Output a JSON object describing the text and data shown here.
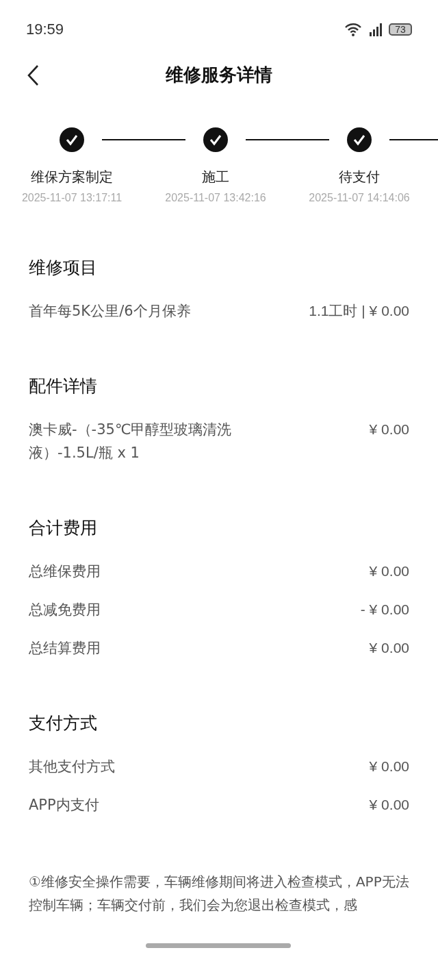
{
  "status_bar": {
    "time": "19:59",
    "battery": "73"
  },
  "header": {
    "title": "维修服务详情"
  },
  "steps": [
    {
      "label": "维保方案制定",
      "time": "2025-11-07 13:17:11",
      "done": true
    },
    {
      "label": "施工",
      "time": "2025-11-07 13:42:16",
      "done": true
    },
    {
      "label": "待支付",
      "time": "2025-11-07 14:14:06",
      "done": true
    }
  ],
  "sections": [
    {
      "title": "维修项目",
      "rows": [
        {
          "name": "首年每5K公里/6个月保养",
          "value": "1.1工时 | ¥ 0.00"
        }
      ]
    },
    {
      "title": "配件详情",
      "rows": [
        {
          "name": "澳卡威-（-35℃甲醇型玻璃清洗液）-1.5L/瓶 x 1",
          "value": "¥ 0.00"
        }
      ]
    },
    {
      "title": "合计费用",
      "rows": [
        {
          "name": "总维保费用",
          "value": "¥ 0.00"
        },
        {
          "name": "总减免费用",
          "value": "- ¥ 0.00"
        },
        {
          "name": "总结算费用",
          "value": "¥ 0.00"
        }
      ]
    },
    {
      "title": "支付方式",
      "rows": [
        {
          "name": "其他支付方式",
          "value": "¥ 0.00"
        },
        {
          "name": "APP内支付",
          "value": "¥ 0.00"
        }
      ]
    }
  ],
  "notice": "①维修安全操作需要，车辆维修期间将进入检查模式，APP无法控制车辆；车辆交付前，我们会为您退出检查模式，感"
}
